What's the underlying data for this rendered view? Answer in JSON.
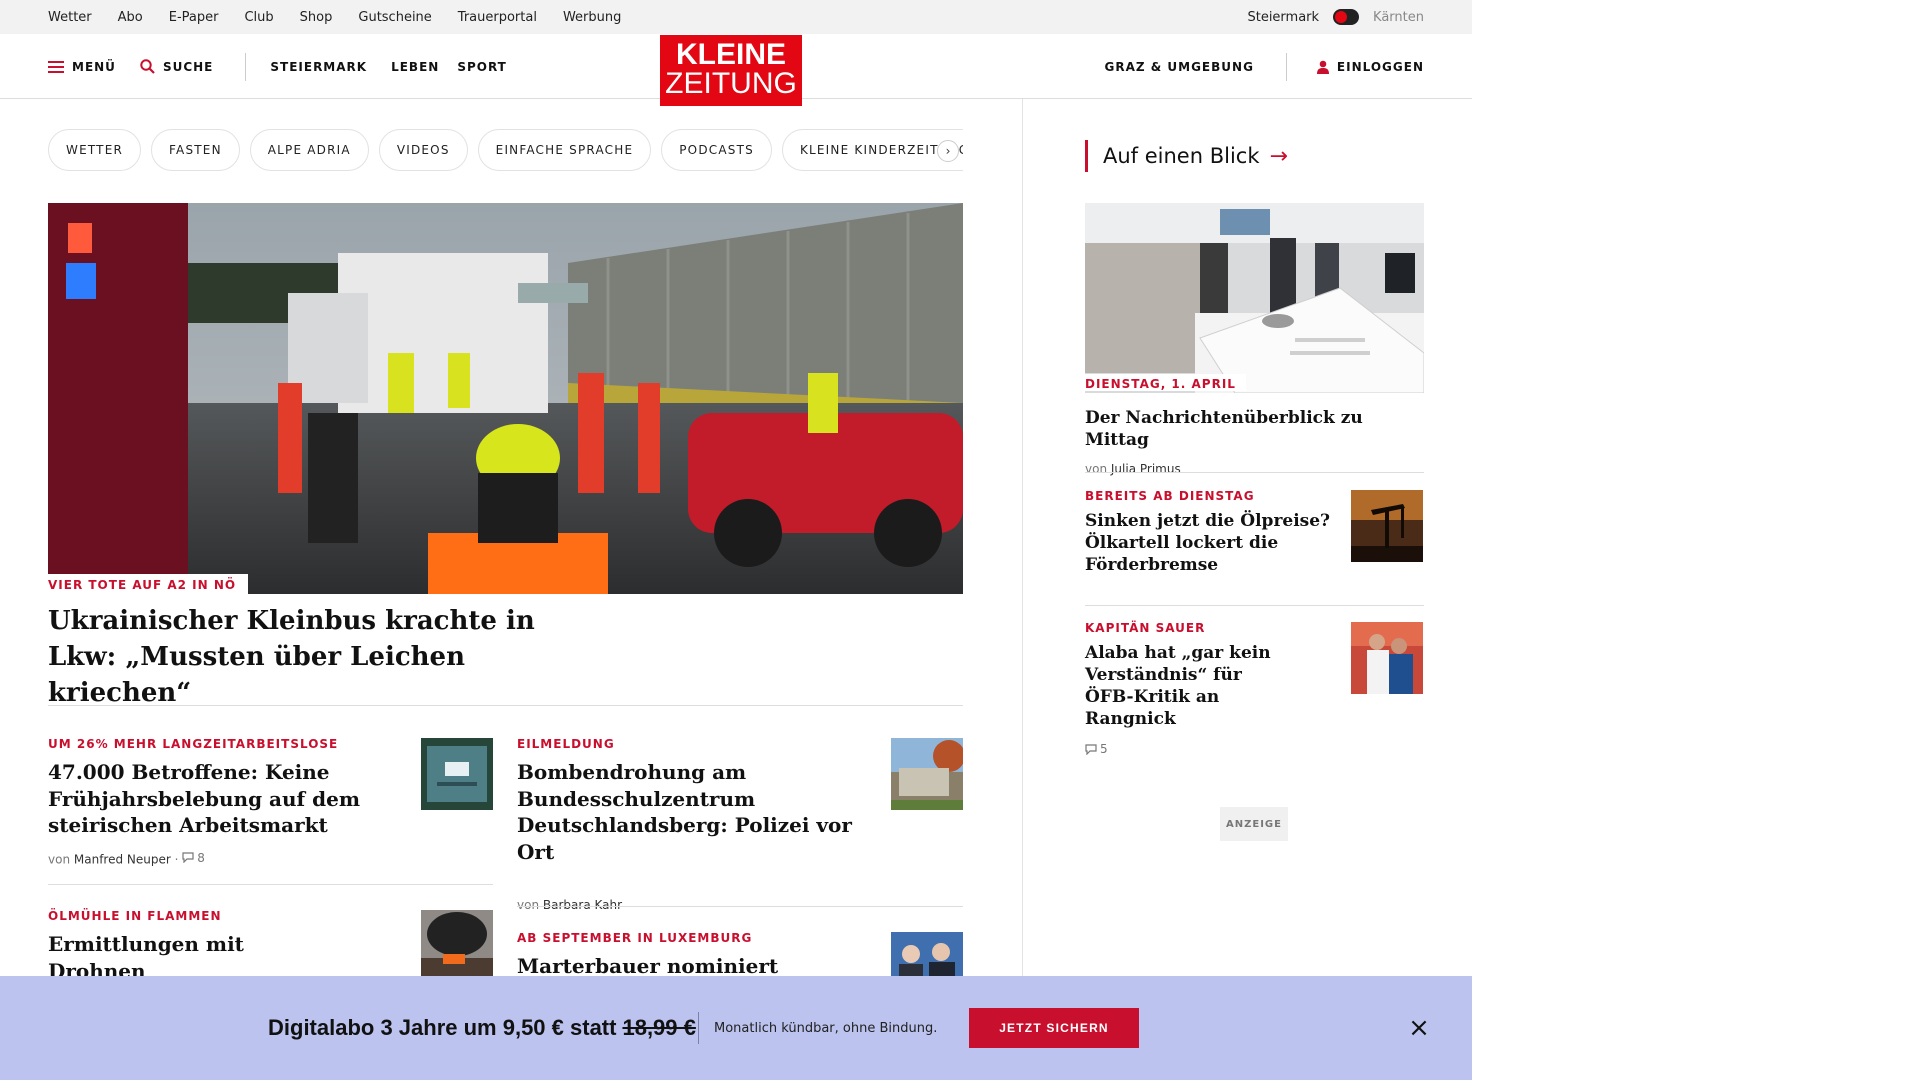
{
  "utility_bar": {
    "links": [
      "Wetter",
      "Abo",
      "E-Paper",
      "Club",
      "Shop",
      "Gutscheine",
      "Trauerportal",
      "Werbung"
    ],
    "region_active": "Steiermark",
    "region_inactive": "Kärnten"
  },
  "nav": {
    "menu_label": "MENÜ",
    "search_label": "SUCHE",
    "sections": [
      "STEIERMARK",
      "LEBEN",
      "SPORT"
    ],
    "logo_line1": "KLEINE",
    "logo_line2": "ZEITUNG",
    "local_label": "GRAZ & UMGEBUNG",
    "login_label": "EINLOGGEN"
  },
  "pills": [
    "WETTER",
    "FASTEN",
    "ALPE ADRIA",
    "VIDEOS",
    "EINFACHE SPRACHE",
    "PODCASTS",
    "KLEINE KINDERZEITUNG"
  ],
  "hero": {
    "kicker": "VIER TOTE AUF A2 IN NÖ",
    "title": "Ukrainischer Kleinbus krachte in Lkw: „Mussten über Leichen kriechen“"
  },
  "teasers": [
    {
      "kicker": "UM 26% MEHR LANGZEITARBEITSLOSE",
      "title": "47.000 Betroffene: Keine Frühjahrsbelebung auf dem steirischen Arbeitsmarkt",
      "by": "von",
      "author": "Manfred Neuper",
      "comments": "8"
    },
    {
      "kicker": "EILMELDUNG",
      "title": "Bombendrohung am Bundesschulzentrum Deutschlandsberg: Polizei vor Ort",
      "by": "von",
      "author": "Barbara Kahr"
    },
    {
      "kicker": "ÖLMÜHLE IN FLAMMEN",
      "title": "Ermittlungen mit Drohnen abgeschlossen"
    },
    {
      "kicker": "AB SEPTEMBER IN LUXEMBURG",
      "title": "Marterbauer nominiert Nehammer"
    }
  ],
  "sidebar": {
    "heading": "Auf einen Blick",
    "heading_arrow": "→",
    "items": [
      {
        "kicker": "DIENSTAG, 1. APRIL",
        "title": "Der Nachrichtenüberblick zu Mittag",
        "by": "von",
        "author": "Julia Primus"
      },
      {
        "kicker": "BEREITS AB DIENSTAG",
        "title": "Sinken jetzt die Ölpreise? Ölkartell lockert die Förderbremse"
      },
      {
        "kicker": "KAPITÄN SAUER",
        "title": "Alaba hat „gar kein Verständnis“ für ÖFB-Kritik an Rangnick",
        "comments": "5"
      }
    ],
    "ad_label": "ANZEIGE"
  },
  "banner": {
    "headline": "Digitalabo 3 Jahre um 9,50 € statt",
    "old_price": "18,99 €",
    "subtext": "Monatlich kündbar, ohne Bindung.",
    "cta": "JETZT SICHERN",
    "close": "×"
  },
  "colors": {
    "brand_red": "#e30613",
    "kicker_red": "#c8102e",
    "banner_bg": "#bcc3ef"
  }
}
